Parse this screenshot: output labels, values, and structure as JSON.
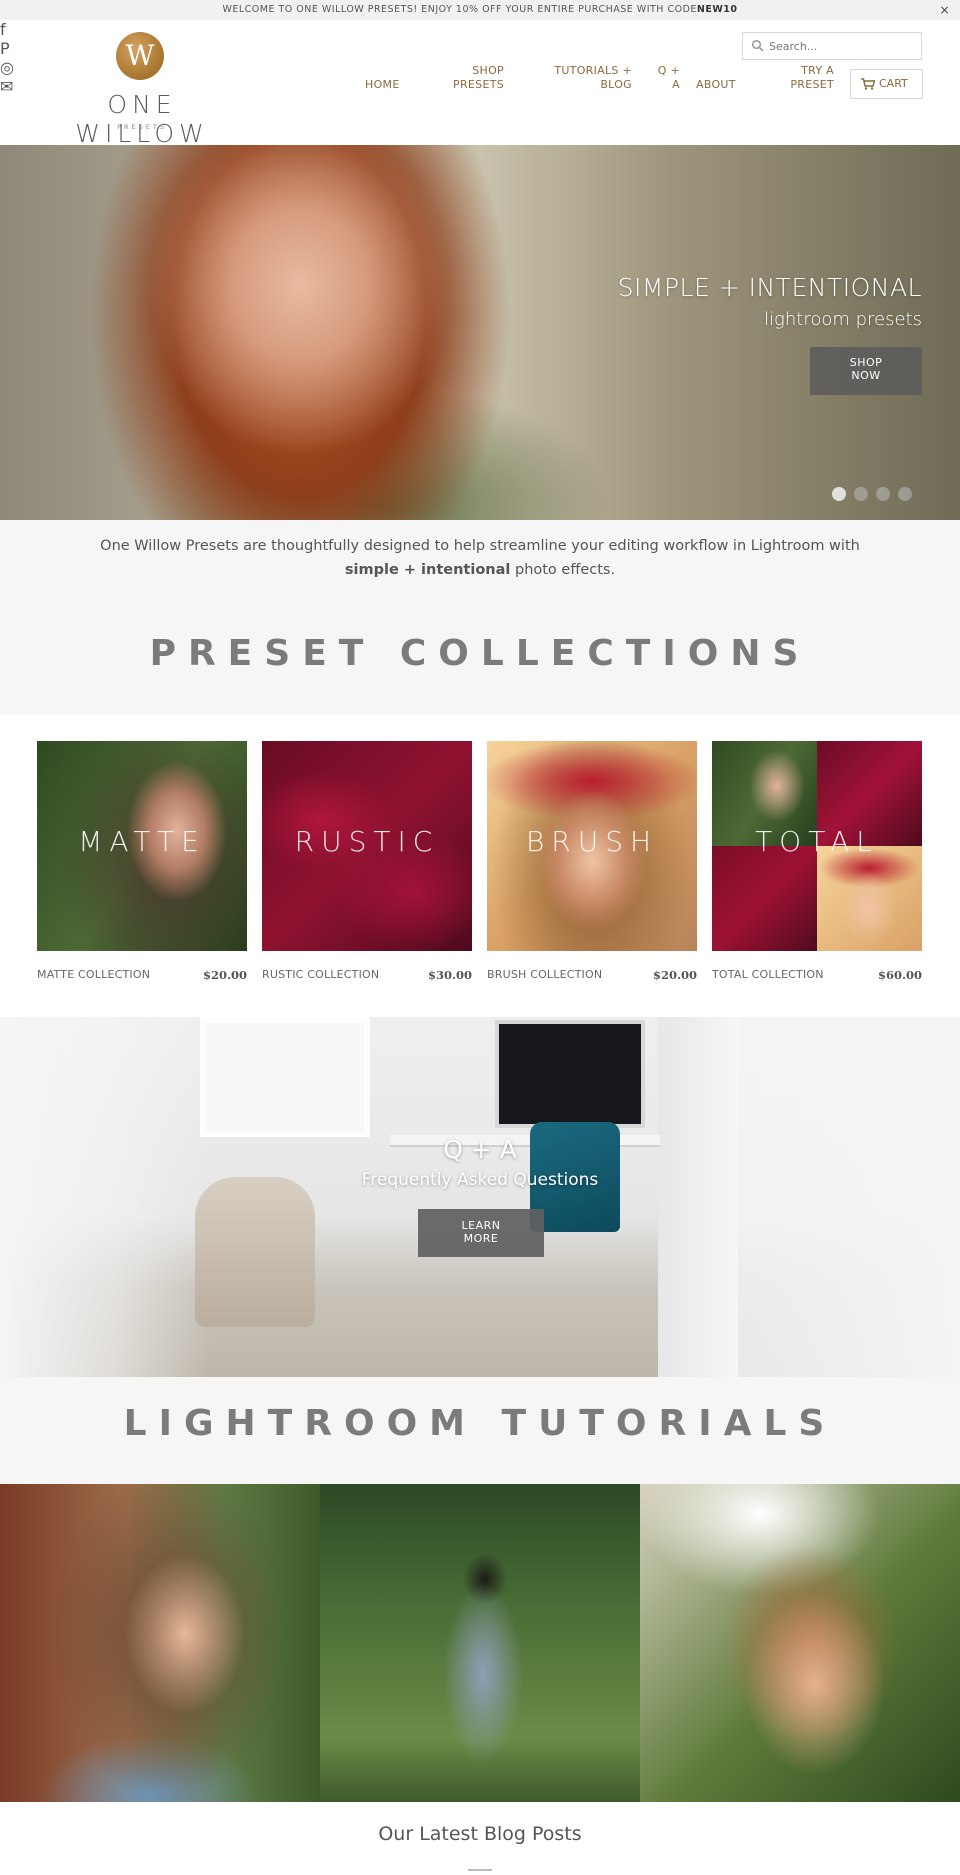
{
  "announcement": {
    "text": "WELCOME TO ONE WILLOW PRESETS! ENJOY 10% OFF YOUR ENTIRE PURCHASE WITH CODE",
    "code": "NEW10",
    "close": "×"
  },
  "brand": {
    "mark": "W",
    "name": "ONE WILLOW",
    "tagline": "PRESETS",
    "accent": "#a7742e"
  },
  "social": [
    {
      "icon": "facebook-icon",
      "glyph": "f"
    },
    {
      "icon": "pinterest-icon",
      "glyph": "P"
    },
    {
      "icon": "instagram-icon",
      "glyph": "◎"
    },
    {
      "icon": "email-icon",
      "glyph": "✉"
    }
  ],
  "search": {
    "placeholder": "Search..."
  },
  "nav": {
    "home": "HOME",
    "shop_1": "SHOP",
    "shop_2": "PRESETS",
    "tutorials_1": "TUTORIALS +",
    "tutorials_2": "BLOG",
    "qa_1": "Q +",
    "qa_2": "A",
    "about": "ABOUT",
    "try_1": "TRY A",
    "try_2": "PRESET",
    "cart": "CART"
  },
  "hero": {
    "title": "SIMPLE + INTENTIONAL",
    "subtitle": "lightroom presets",
    "button_1": "SHOP",
    "button_2": "NOW",
    "slides": 4,
    "active_slide": 1
  },
  "intro": {
    "part1": "One Willow Presets are thoughtfully designed to help streamline your editing workflow in Lightroom with ",
    "bold": "simple + intentional",
    "part2": " photo effects."
  },
  "collections_heading": "PRESET COLLECTIONS",
  "collections": [
    {
      "overlay": "MATTE",
      "name": "MATTE COLLECTION",
      "price": "$20.00"
    },
    {
      "overlay": "RUSTIC",
      "name": "RUSTIC COLLECTION",
      "price": "$30.00"
    },
    {
      "overlay": "BRUSH",
      "name": "BRUSH COLLECTION",
      "price": "$20.00"
    },
    {
      "overlay": "TOTAL",
      "name": "TOTAL COLLECTION",
      "price": "$60.00"
    }
  ],
  "qa": {
    "title": "Q + A",
    "subtitle": "Frequently Asked Questions",
    "button_1": "LEARN",
    "button_2": "MORE"
  },
  "tutorials_heading": "LIGHTROOM TUTORIALS",
  "blog_heading": "Our Latest Blog Posts"
}
